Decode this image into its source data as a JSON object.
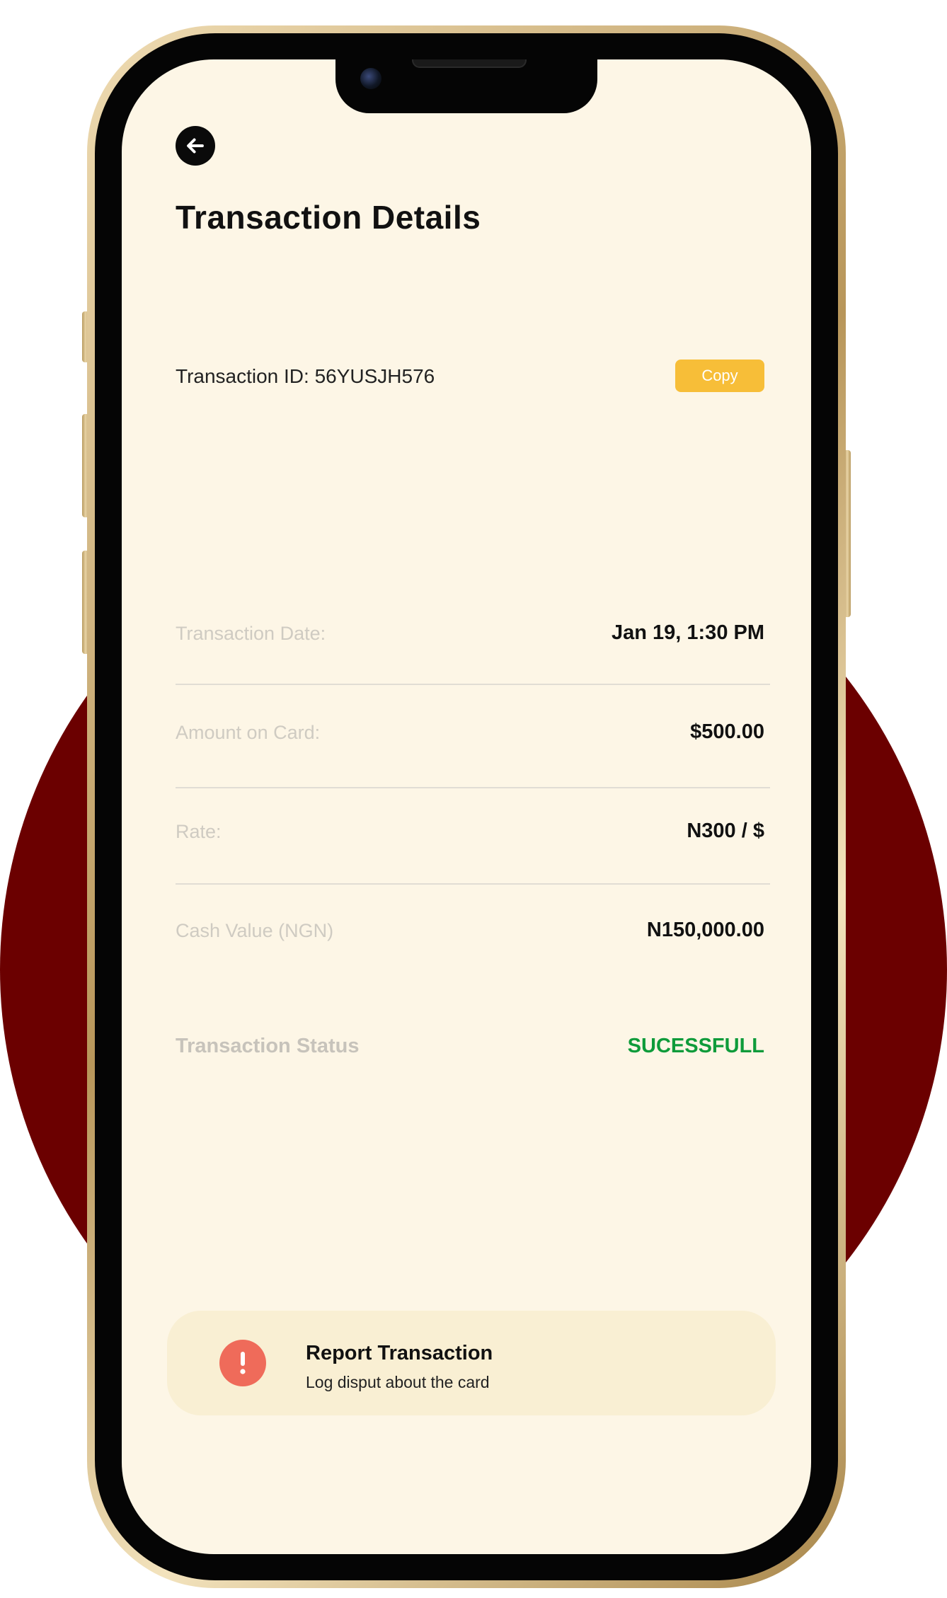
{
  "header": {
    "title": "Transaction Details",
    "back_icon": "arrow-left-icon"
  },
  "transaction": {
    "id_text": "Transaction ID: 56YUSJH576",
    "copy_label": "Copy",
    "copy_color": "#f7be38"
  },
  "details": [
    {
      "label": "Transaction Date:",
      "value": "Jan 19, 1:30 PM"
    },
    {
      "label": "Amount on Card:",
      "value": "$500.00"
    },
    {
      "label": "Rate:",
      "value": "N300 / $"
    },
    {
      "label": "Cash Value (NGN)",
      "value": "N150,000.00"
    }
  ],
  "status": {
    "label": "Transaction Status",
    "value": "SUCESSFULL",
    "color": "#0e9b3a"
  },
  "report": {
    "icon": "alert-icon",
    "title": "Report Transaction",
    "subtitle": "Log disput about the card"
  },
  "colors": {
    "background_circle": "#6b0000",
    "screen": "#fdf6e6",
    "report_card": "#f9efd3",
    "alert": "#ef6b5a"
  }
}
